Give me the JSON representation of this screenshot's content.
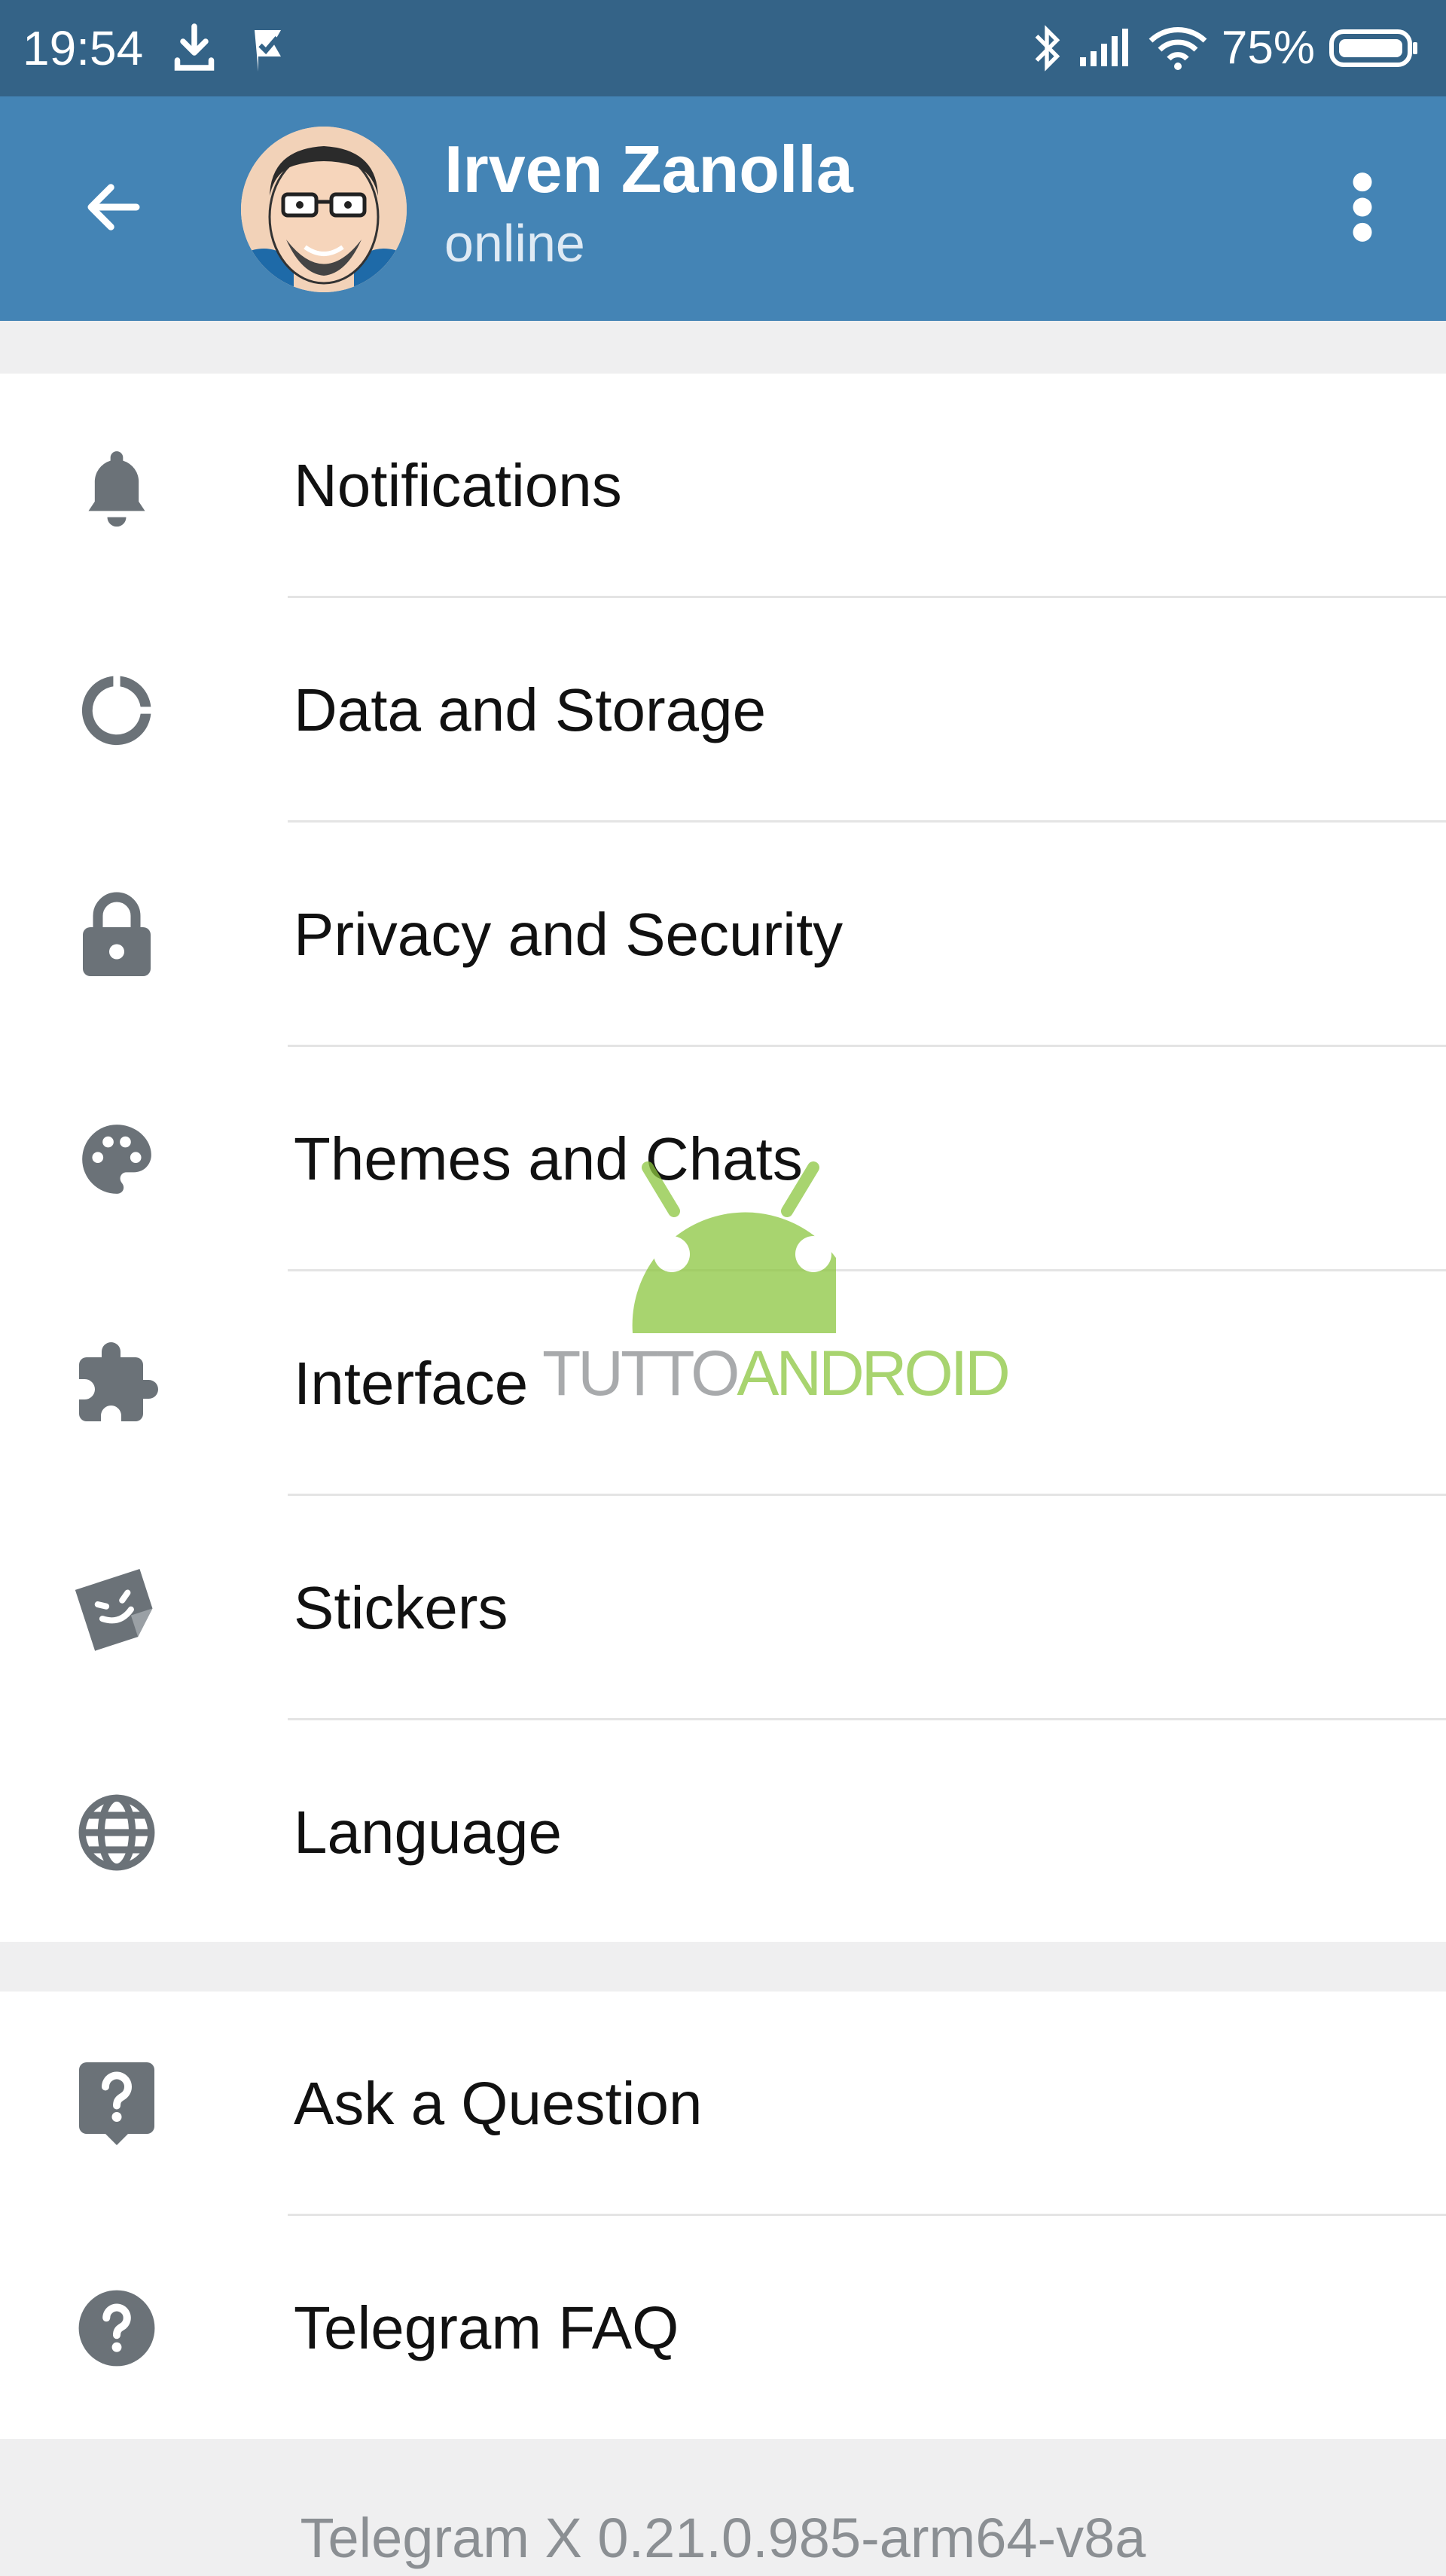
{
  "status_bar": {
    "time": "19:54",
    "battery_percent": "75%",
    "icons": [
      "download-icon",
      "check-flag-icon",
      "bluetooth-icon",
      "cell-signal-icon",
      "wifi-icon",
      "battery-icon"
    ]
  },
  "app_bar": {
    "back_icon": "arrow-left-icon",
    "name": "Irven Zanolla",
    "status": "online",
    "menu_icon": "more-vert-icon",
    "color": "#4484b5"
  },
  "settings": {
    "group1": [
      {
        "label": "Notifications",
        "icon": "bell-icon"
      },
      {
        "label": "Data and Storage",
        "icon": "donut-chart-icon"
      },
      {
        "label": "Privacy and Security",
        "icon": "lock-icon"
      },
      {
        "label": "Themes and Chats",
        "icon": "palette-icon"
      },
      {
        "label": "Interface",
        "icon": "puzzle-icon"
      },
      {
        "label": "Stickers",
        "icon": "sticker-icon"
      },
      {
        "label": "Language",
        "icon": "globe-icon"
      }
    ],
    "group2": [
      {
        "label": "Ask a Question",
        "icon": "question-bubble-icon"
      },
      {
        "label": "Telegram FAQ",
        "icon": "help-circle-icon"
      }
    ]
  },
  "footer": {
    "version": "Telegram X 0.21.0.985-arm64-v8a"
  },
  "watermark": {
    "part1": "TUTTO",
    "part2": "ANDROID"
  }
}
